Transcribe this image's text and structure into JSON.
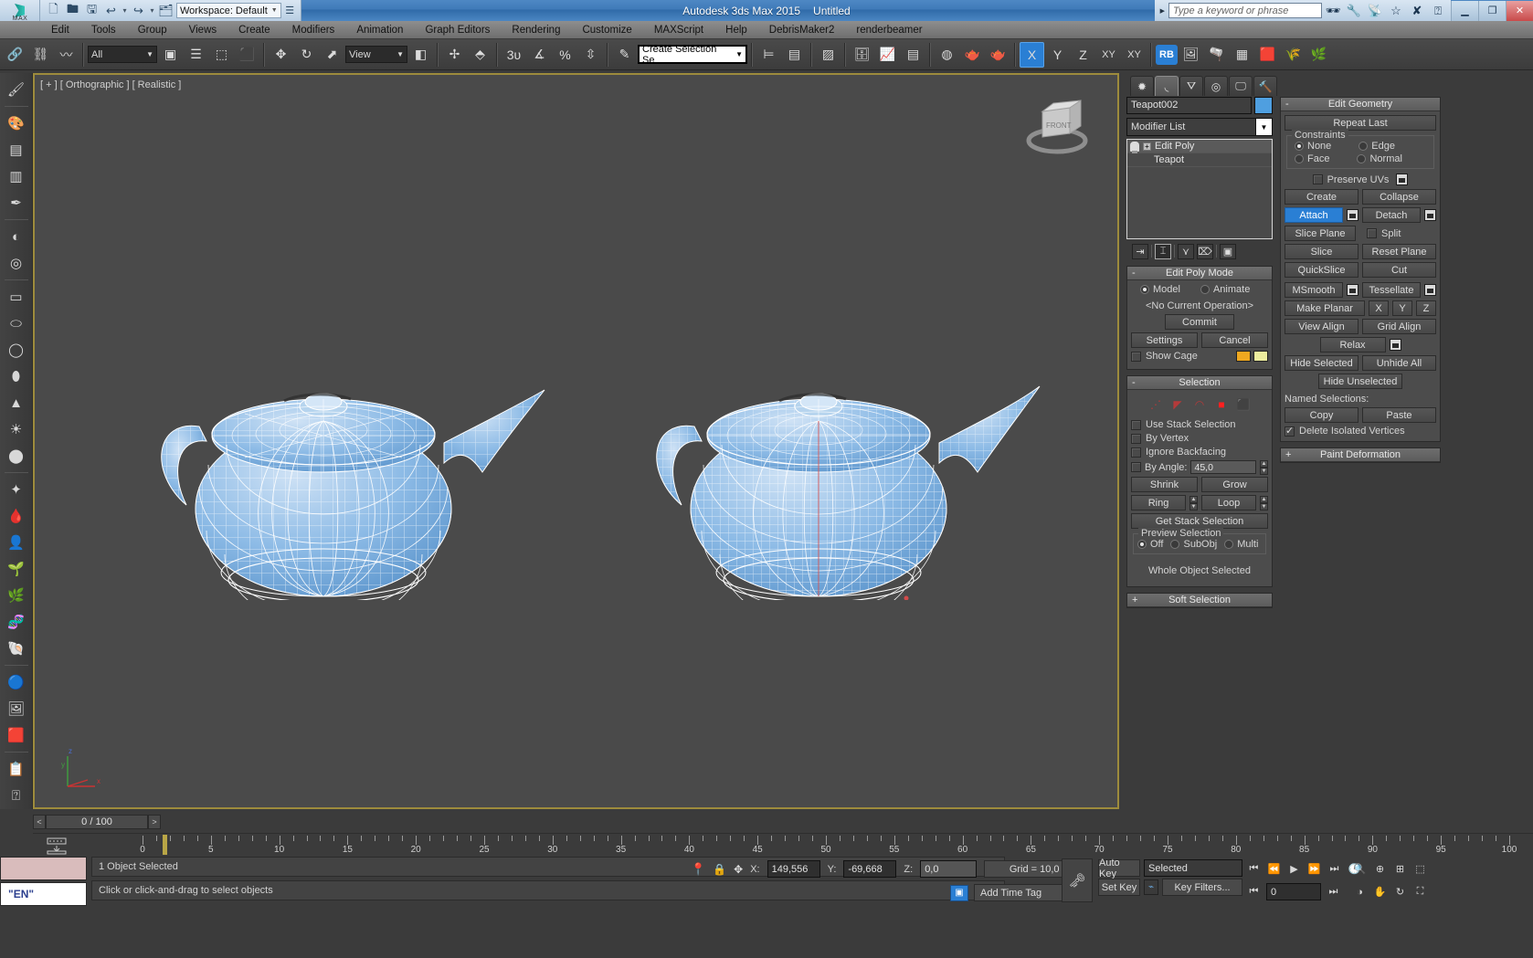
{
  "title_bar": {
    "app_title": "Autodesk 3ds Max  2015",
    "document": "Untitled",
    "workspace": "Workspace: Default",
    "search_placeholder": "Type a keyword or phrase",
    "quick_icons": [
      "new-file-icon",
      "open-file-icon",
      "save-icon",
      "undo-icon",
      "redo-icon",
      "set-project-icon"
    ],
    "right_icons": [
      "binoculars-icon",
      "wrench-icon",
      "satellite-icon",
      "star-icon",
      "exchange-icon",
      "help-arrow-icon"
    ],
    "window_buttons": [
      "minimize",
      "maximize",
      "close"
    ]
  },
  "menu": {
    "items": [
      "Edit",
      "Tools",
      "Group",
      "Views",
      "Create",
      "Modifiers",
      "Animation",
      "Graph Editors",
      "Rendering",
      "Customize",
      "MAXScript",
      "Help",
      "DebrisMaker2",
      "renderbeamer"
    ]
  },
  "toolbar": {
    "selection_filter": "All",
    "reference_coord": "View",
    "named_selection_set": "Create Selection Se",
    "axis_constraints": [
      "X",
      "Y",
      "Z",
      "XY",
      "XY"
    ],
    "rb_label": "RB",
    "groups": [
      [
        "link-icon",
        "unlink-icon",
        "bind-space-warp-icon"
      ],
      [
        "select-object-icon",
        "select-by-name-icon",
        "rect-select-icon",
        "window-crossing-icon"
      ],
      [
        "select-move-icon",
        "select-rotate-icon",
        "select-scale-icon"
      ],
      [
        "use-pivot-center-icon"
      ],
      [
        "snap-3d-icon",
        "angle-snap-icon",
        "percent-snap-icon",
        "spinner-snap-icon"
      ],
      [
        "edit-named-selection-icon"
      ],
      [
        "mirror-icon",
        "align-icon"
      ],
      [
        "layer-manager-icon",
        "toggle-scene-explorer-icon",
        "curve-editor-icon",
        "schematic-view-icon"
      ],
      [
        "material-editor-icon",
        "render-setup-icon",
        "rendered-frame-icon",
        "render-production-icon"
      ]
    ]
  },
  "viewport": {
    "label": "[ + ] [ Orthographic ] [ Realistic ]",
    "view_cube_label": "FRONT",
    "axis_labels": [
      "z",
      "y",
      "x"
    ],
    "objects": [
      "Teapot001 wireframe",
      "Teapot002 wireframe"
    ]
  },
  "command_panel": {
    "tabs": [
      "create-tab",
      "modify-tab",
      "hierarchy-tab",
      "motion-tab",
      "display-tab",
      "utilities-tab"
    ],
    "selected_tab_index": 1,
    "object_name": "Teapot002",
    "object_color": "#4f9fe0",
    "modifier_list_label": "Modifier List",
    "stack": [
      {
        "label": "Edit Poly",
        "selected": true
      },
      {
        "label": "Teapot",
        "selected": false
      }
    ],
    "stack_buttons": [
      "pin-stack-icon",
      "show-end-result-icon",
      "make-unique-icon",
      "remove-modifier-icon",
      "configure-sets-icon"
    ],
    "rollouts": {
      "edit_poly_mode": {
        "title": "Edit Poly Mode",
        "modes": [
          "Model",
          "Animate"
        ],
        "selected_mode": "Model",
        "current_operation": "<No Current Operation>",
        "commit_label": "Commit",
        "settings_label": "Settings",
        "cancel_label": "Cancel",
        "show_cage_label": "Show Cage",
        "cage_color_1": "#f0a820",
        "cage_color_2": "#eded9e"
      },
      "selection": {
        "title": "Selection",
        "sub_object_icons": [
          "vertex-icon",
          "edge-icon",
          "border-icon",
          "polygon-icon",
          "element-icon"
        ],
        "checkboxes": [
          {
            "label": "Use Stack Selection",
            "checked": false
          },
          {
            "label": "By Vertex",
            "checked": false
          },
          {
            "label": "Ignore Backfacing",
            "checked": false
          }
        ],
        "by_angle_label": "By Angle:",
        "by_angle_value": "45,0",
        "by_angle_checked": false,
        "shrink_label": "Shrink",
        "grow_label": "Grow",
        "ring_label": "Ring",
        "loop_label": "Loop",
        "get_stack_selection_label": "Get Stack Selection",
        "preview_selection_title": "Preview Selection",
        "preview_options": [
          "Off",
          "SubObj",
          "Multi"
        ],
        "preview_selected": "Off",
        "status": "Whole Object Selected"
      },
      "soft_selection": {
        "title": "Soft Selection"
      },
      "edit_geometry": {
        "title": "Edit Geometry",
        "repeat_last": "Repeat Last",
        "constraints_title": "Constraints",
        "constraints": [
          "None",
          "Edge",
          "Face",
          "Normal"
        ],
        "constraint_selected": "None",
        "preserve_uvs": "Preserve UVs",
        "preserve_uvs_checked": false,
        "buttons": [
          [
            "Create",
            "Collapse"
          ],
          [
            "Attach",
            "Detach"
          ],
          [
            "Slice Plane",
            "Split"
          ],
          [
            "Slice",
            "Reset Plane"
          ],
          [
            "QuickSlice",
            "Cut"
          ],
          [
            "MSmooth",
            "Tessellate"
          ],
          [
            "Make Planar",
            "X",
            "Y",
            "Z"
          ],
          [
            "View Align",
            "Grid Align"
          ],
          [
            "Relax"
          ],
          [
            "Hide Selected",
            "Unhide All"
          ],
          [
            "Hide Unselected"
          ]
        ],
        "attach_active": true,
        "split_checked": false,
        "named_selections_label": "Named Selections:",
        "copy_label": "Copy",
        "paste_label": "Paste",
        "delete_isolated_vertices": "Delete Isolated Vertices",
        "delete_isolated_checked": true
      },
      "paint_deformation": {
        "title": "Paint Deformation"
      }
    }
  },
  "timeline": {
    "frame_display": "0 / 100",
    "prev_label": "<",
    "next_label": ">",
    "tick_labels": [
      "5",
      "10",
      "15",
      "20",
      "25",
      "30",
      "35",
      "40",
      "45",
      "50",
      "55",
      "60",
      "65",
      "70",
      "75",
      "80",
      "85",
      "90",
      "95",
      "100"
    ],
    "tick_start": "0"
  },
  "status_bar": {
    "mx_language": "\"EN\"",
    "prompt_line_1": "1 Object Selected",
    "prompt_line_2": "Click or click-and-drag to select objects",
    "coords": [
      {
        "label": "X:",
        "value": "149,556"
      },
      {
        "label": "Y:",
        "value": "-69,668"
      },
      {
        "label": "Z:",
        "value": "0,0"
      }
    ],
    "grid_label": "Grid = 10,0",
    "add_time_tag": "Add Time Tag",
    "auto_key": "Auto Key",
    "set_key": "Set Key",
    "key_filters": "Key Filters...",
    "selected_list": "Selected",
    "key_field_value": "0",
    "nav_icons": [
      "zoom-icon",
      "zoom-all-icon",
      "zoom-extents-icon",
      "field-of-view-icon",
      "pan-icon",
      "orbit-icon",
      "maximize-viewport-icon"
    ],
    "playback_icons": [
      "go-to-start-icon",
      "previous-frame-icon",
      "play-icon",
      "next-frame-icon",
      "go-to-end-icon"
    ]
  }
}
